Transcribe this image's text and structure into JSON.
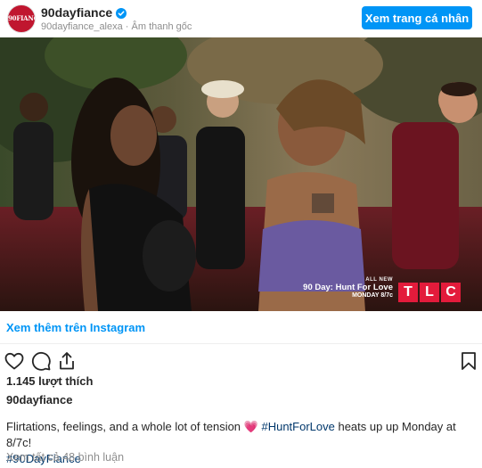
{
  "header": {
    "avatar_text": "90FIANCE",
    "username": "90dayfiance",
    "verified": true,
    "subline": "90dayfiance_alexa · Âm thanh gốc",
    "profile_button": "Xem trang cá nhân"
  },
  "media": {
    "watermark_new": "ALL NEW",
    "watermark_show": "90 Day: Hunt For Love",
    "watermark_time": "MONDAY 8/7c",
    "network_letters": [
      "T",
      "L",
      "C"
    ]
  },
  "view_more": "Xem thêm trên Instagram",
  "actions": {
    "like": "heart-icon",
    "comment": "comment-icon",
    "share": "share-icon",
    "save": "bookmark-icon"
  },
  "likes": "1.145 lượt thích",
  "caption": {
    "author": "90dayfiance",
    "text_before": "Flirtations, feelings, and a whole lot of tension ",
    "emoji": "💗",
    "hashtag1": "#HuntForLove",
    "text_after": " heats up up Monday at 8/7c!",
    "hashtag2": "#90DayFiance"
  },
  "comments_link": "Xem tất cả 48 bình luận",
  "colors": {
    "accent": "#0095f6",
    "hashtag": "#00376b",
    "tlc_red": "#e31b3b",
    "avatar_bg": "#c0162f"
  }
}
